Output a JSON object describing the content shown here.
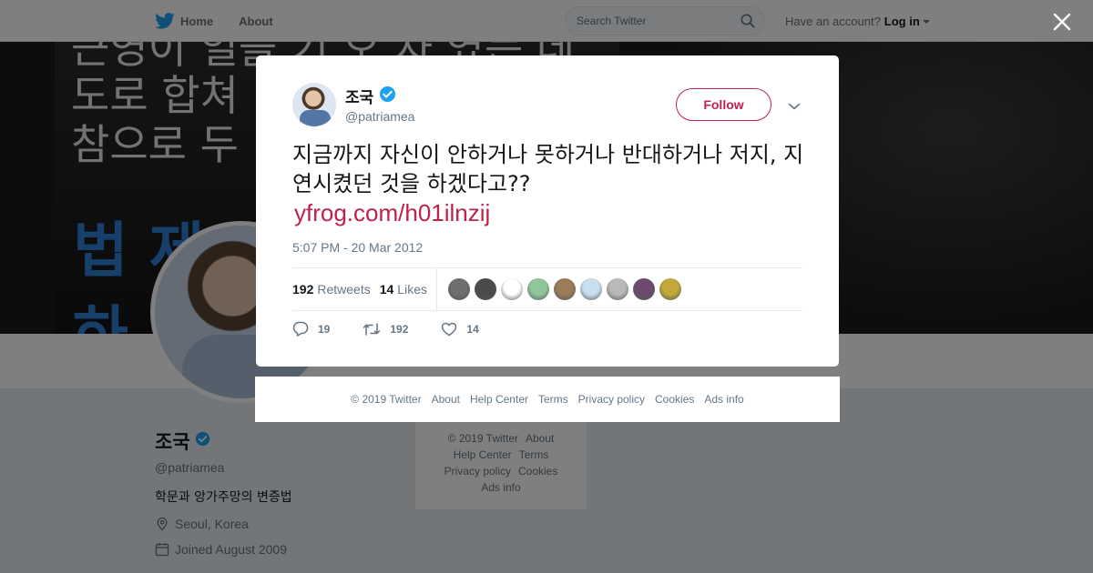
{
  "nav": {
    "home_label": "Home",
    "about_label": "About",
    "search_placeholder": "Search Twitter",
    "account_prompt": "Have an account?",
    "login_label": "Log in"
  },
  "banner": {
    "line1": "근영이 일을 기 오 자 였는 데",
    "line2": "도로 합쳐",
    "line3": "참으로 두",
    "blue1": "법 제",
    "blue2": "하"
  },
  "profile": {
    "name": "조국",
    "handle": "@patriamea",
    "bio": "학문과 앙가주망의 변증법",
    "location": "Seoul, Korea",
    "joined": "Joined August 2009"
  },
  "background_footer": {
    "links": [
      "© 2019 Twitter",
      "About",
      "Help Center",
      "Terms",
      "Privacy policy",
      "Cookies",
      "Ads info"
    ]
  },
  "tweet": {
    "author_name": "조국",
    "author_handle": "@patriamea",
    "follow_label": "Follow",
    "text": "지금까지 자신이 안하거나 못하거나 반대하거나 저지, 지연시켰던 것을 하겠다고??",
    "link": "yfrog.com/h01ilnzij",
    "timestamp": "5:07 PM - 20 Mar 2012",
    "retweets_count": "192",
    "retweets_label": "Retweets",
    "likes_count": "14",
    "likes_label": "Likes",
    "liker_avatar_colors": [
      "#6e6e6e",
      "#4a4a4a",
      "#ffffff",
      "#8fc79a",
      "#9a7b5a",
      "#c9dff0",
      "#b9b9b9",
      "#6d4b6e",
      "#c2a93a"
    ],
    "reply_count": "19",
    "retweet_action_count": "192",
    "like_action_count": "14"
  },
  "modal_footer": {
    "links": [
      "© 2019 Twitter",
      "About",
      "Help Center",
      "Terms",
      "Privacy policy",
      "Cookies",
      "Ads info"
    ]
  },
  "colors": {
    "accent": "#c0214a",
    "twitter_blue": "#1da1f2",
    "muted_text": "#657786"
  }
}
